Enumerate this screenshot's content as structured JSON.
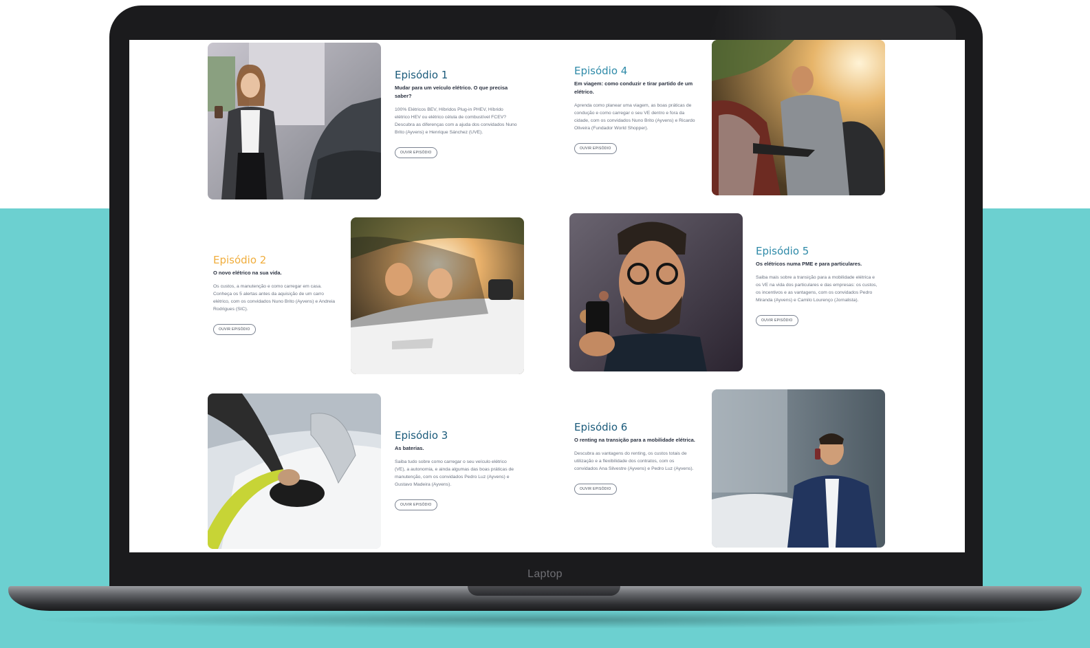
{
  "device_label": "Laptop",
  "colors": {
    "background_teal": "#6cd0d0",
    "title_blue": "#1a5a7a",
    "title_teal": "#2e8aa8",
    "title_orange": "#f0ad3c"
  },
  "episodes": [
    {
      "title": "Episódio 1",
      "subtitle": "Mudar para um veículo elétrico. O que precisa saber?",
      "description": "100% Elétricos BEV, Híbridos Plug-in PHEV, Híbrido elétrico HEV ou elétrico célula de combustível FCEV? Descubra as diferenças com a ajuda dos convidados Nuno Brito (Ayvens) e Henrique Sánchez (UVE).",
      "button": "OUVIR EPISÓDIO",
      "image": "woman-charging-car-photo"
    },
    {
      "title": "Episódio 4",
      "subtitle": "Em viagem: como conduzir e tirar partido de um elétrico.",
      "description": "Aprenda como planear uma viagem, as boas práticas de condução e como carregar o seu VE dentro e fora da cidade, com os convidados Nuno Brito (Ayvens) e Ricardo Oliveira (Fundador World Shopper).",
      "button": "OUVIR EPISÓDIO",
      "image": "man-plugging-charger-photo"
    },
    {
      "title": "Episódio 2",
      "subtitle": "O novo elétrico na sua vida.",
      "description": "Os custos, a manutenção e como carregar em casa. Conheça os 5 alertas antes da aquisição de um carro elétrico, com os convidados Nuno Brito (Ayvens) e Andreia Rodrigues (SIC).",
      "button": "OUVIR EPISÓDIO",
      "image": "kids-in-car-window-photo"
    },
    {
      "title": "Episódio 5",
      "subtitle": "Os elétricos numa PME e para particulares.",
      "description": "Saiba mais sobre a transição para a mobilidade elétrica e os VE na vida dos particulares e das empresas: os custos, os incentivos e as vantagens, com os convidados Pedro Miranda (Ayvens) e Camilo Lourenço (Jornalista).",
      "button": "OUVIR EPISÓDIO",
      "image": "man-with-phone-glasses-photo"
    },
    {
      "title": "Episódio 3",
      "subtitle": "As baterias.",
      "description": "Saiba tudo sobre como carregar o seu veículo elétrico (VE), a autonomia, e ainda algumas das boas práticas de manutenção, com os convidados Pedro Luz (Ayvens) e Gustavo Madeira (Ayvens).",
      "button": "OUVIR EPISÓDIO",
      "image": "charging-plug-closeup-photo"
    },
    {
      "title": "Episódio 6",
      "subtitle": "O renting na transição para a mobilidade elétrica.",
      "description": "Descubra as vantagens do renting, os custos totais de utilização e a flexibilidade dos contratos, com os convidados Ana Silvestre (Ayvens) e Pedro Luz (Ayvens).",
      "button": "OUVIR EPISÓDIO",
      "image": "businessman-on-phone-photo"
    }
  ]
}
